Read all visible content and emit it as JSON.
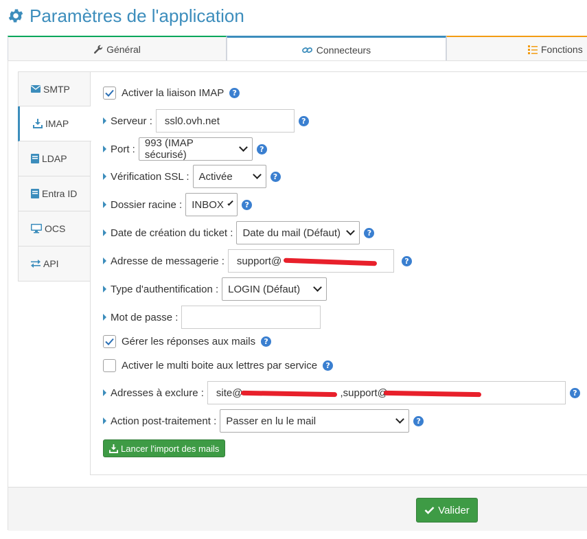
{
  "page": {
    "title": "Paramètres de l'application"
  },
  "tabs": [
    {
      "label": "Général",
      "icon": "wrench-icon"
    },
    {
      "label": "Connecteurs",
      "icon": "link-icon"
    },
    {
      "label": "Fonctions",
      "icon": "list-check-icon"
    }
  ],
  "sidebar": {
    "items": [
      {
        "label": "SMTP",
        "icon": "envelope-icon"
      },
      {
        "label": "IMAP",
        "icon": "download-icon",
        "active": true
      },
      {
        "label": "LDAP",
        "icon": "book-icon"
      },
      {
        "label": "Entra ID",
        "icon": "book-icon"
      },
      {
        "label": "OCS",
        "icon": "desktop-icon"
      },
      {
        "label": "API",
        "icon": "exchange-icon"
      }
    ]
  },
  "form": {
    "enable_imap": {
      "label": "Activer la liaison IMAP",
      "checked": true
    },
    "server": {
      "label": "Serveur :",
      "value": "ssl0.ovh.net"
    },
    "port": {
      "label": "Port :",
      "value": "993 (IMAP sécurisé)"
    },
    "ssl_check": {
      "label": "Vérification SSL :",
      "value": "Activée"
    },
    "root_folder": {
      "label": "Dossier racine :",
      "value": "INBOX"
    },
    "ticket_date": {
      "label": "Date de création du ticket :",
      "value": "Date du mail (Défaut)"
    },
    "mail_address": {
      "label": "Adresse de messagerie :",
      "value": "support@"
    },
    "auth_type": {
      "label": "Type d'authentification :",
      "value": "LOGIN (Défaut)"
    },
    "password": {
      "label": "Mot de passe :",
      "value": ""
    },
    "manage_replies": {
      "label": "Gérer les réponses aux mails",
      "checked": true
    },
    "multi_mailbox": {
      "label": "Activer le multi boite aux lettres par service",
      "checked": false
    },
    "exclude_addresses": {
      "label": "Adresses à exclure :",
      "value_part1": "site@",
      "value_part2": ",support@"
    },
    "post_action": {
      "label": "Action post-traitement :",
      "value": "Passer en lu le mail"
    },
    "import_button": "Lancer l'import des mails",
    "help_symbol": "?"
  },
  "footer": {
    "submit_label": "Valider"
  },
  "colors": {
    "primary": "#3c8dbc",
    "success": "#3e9b45",
    "general_tab": "#00a65a",
    "functions_tab": "#f39c12",
    "redaction": "#e8202b"
  }
}
